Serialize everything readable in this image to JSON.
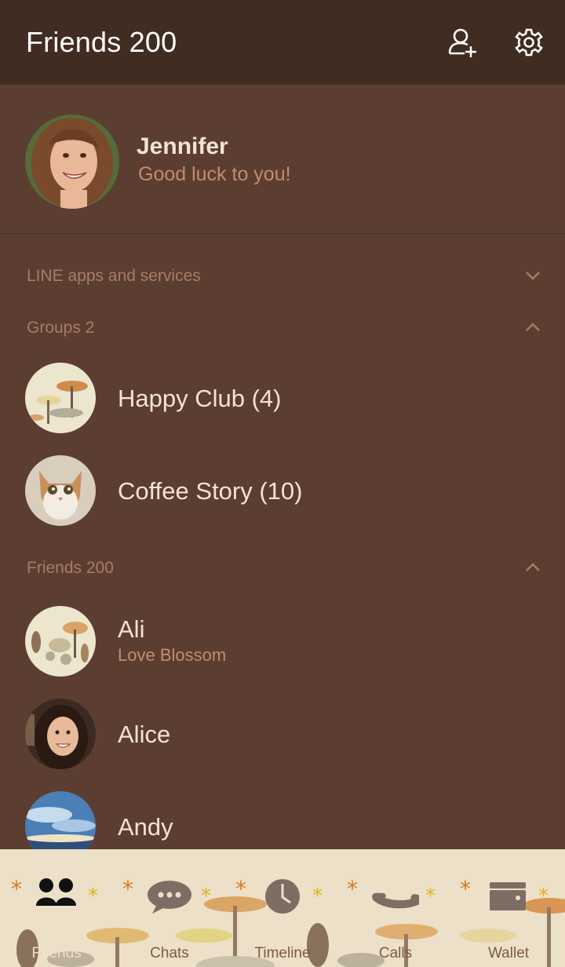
{
  "header": {
    "title": "Friends 200",
    "add_friend_icon": "add-friend-icon",
    "settings_icon": "gear-icon"
  },
  "profile": {
    "name": "Jennifer",
    "status": "Good luck to you!"
  },
  "sections": {
    "apps": {
      "label": "LINE apps and services",
      "expanded": false
    },
    "groups": {
      "label": "Groups 2",
      "expanded": true
    },
    "friends": {
      "label": "Friends 200",
      "expanded": true
    }
  },
  "groups": [
    {
      "name": "Happy Club (4)"
    },
    {
      "name": "Coffee Story (10)"
    }
  ],
  "friends": [
    {
      "name": "Ali",
      "status": "Love Blossom"
    },
    {
      "name": "Alice",
      "status": ""
    },
    {
      "name": "Andy",
      "status": ""
    }
  ],
  "tabs": [
    {
      "label": "Friends",
      "icon": "friends-icon",
      "active": true
    },
    {
      "label": "Chats",
      "icon": "chat-bubble-icon",
      "active": false
    },
    {
      "label": "Timeline",
      "icon": "clock-icon",
      "active": false
    },
    {
      "label": "Calls",
      "icon": "phone-icon",
      "active": false
    },
    {
      "label": "Wallet",
      "icon": "wallet-icon",
      "active": false
    }
  ],
  "colors": {
    "header_bg": "#412c22",
    "body_bg": "#5c3d31",
    "accent_text": "#c48b70",
    "tabbar_bg": "#ede0c8"
  }
}
